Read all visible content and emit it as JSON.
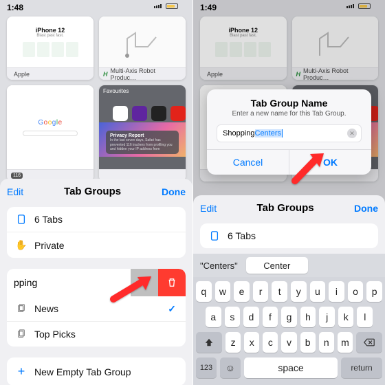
{
  "left": {
    "time": "1:48",
    "cards": {
      "apple": {
        "title": "iPhone 12",
        "subtitle": "Blast past fast.",
        "caption": "Apple",
        "caption_icon": ""
      },
      "robot": {
        "caption": "Multi-Axis Robot Produc…",
        "caption_icon_label": "H"
      },
      "google": {
        "caption": "116"
      },
      "fav": {
        "header": "Favourites",
        "privacy_title": "Privacy Report",
        "privacy_body": "In the last seven days, Safari has prevented 116 trackers from profiling you and hidden your IP address from"
      }
    },
    "sheet": {
      "edit": "Edit",
      "title": "Tab Groups",
      "done": "Done",
      "rows": {
        "tabs": "6 Tabs",
        "private": "Private"
      },
      "swiped_label": "pping",
      "groups": {
        "news": "News",
        "top": "Top Picks"
      },
      "new_group": "New Empty Tab Group"
    }
  },
  "right": {
    "time": "1:49",
    "dialog": {
      "title": "Tab Group Name",
      "subtitle": "Enter a new name for this Tab Group.",
      "input_prefix": "Shopping ",
      "input_selected": "Centers",
      "cancel": "Cancel",
      "ok": "OK"
    },
    "sheet": {
      "edit": "Edit",
      "title": "Tab Groups",
      "done": "Done",
      "rows": {
        "tabs": "6 Tabs"
      }
    },
    "suggestions": {
      "quoted": "\"Centers\"",
      "candidate": "Center"
    },
    "keyboard": {
      "r1": [
        "q",
        "w",
        "e",
        "r",
        "t",
        "y",
        "u",
        "i",
        "o",
        "p"
      ],
      "r2": [
        "a",
        "s",
        "d",
        "f",
        "g",
        "h",
        "j",
        "k",
        "l"
      ],
      "r3": [
        "z",
        "x",
        "c",
        "v",
        "b",
        "n",
        "m"
      ],
      "num": "123",
      "space": "space",
      "return": "return"
    }
  }
}
